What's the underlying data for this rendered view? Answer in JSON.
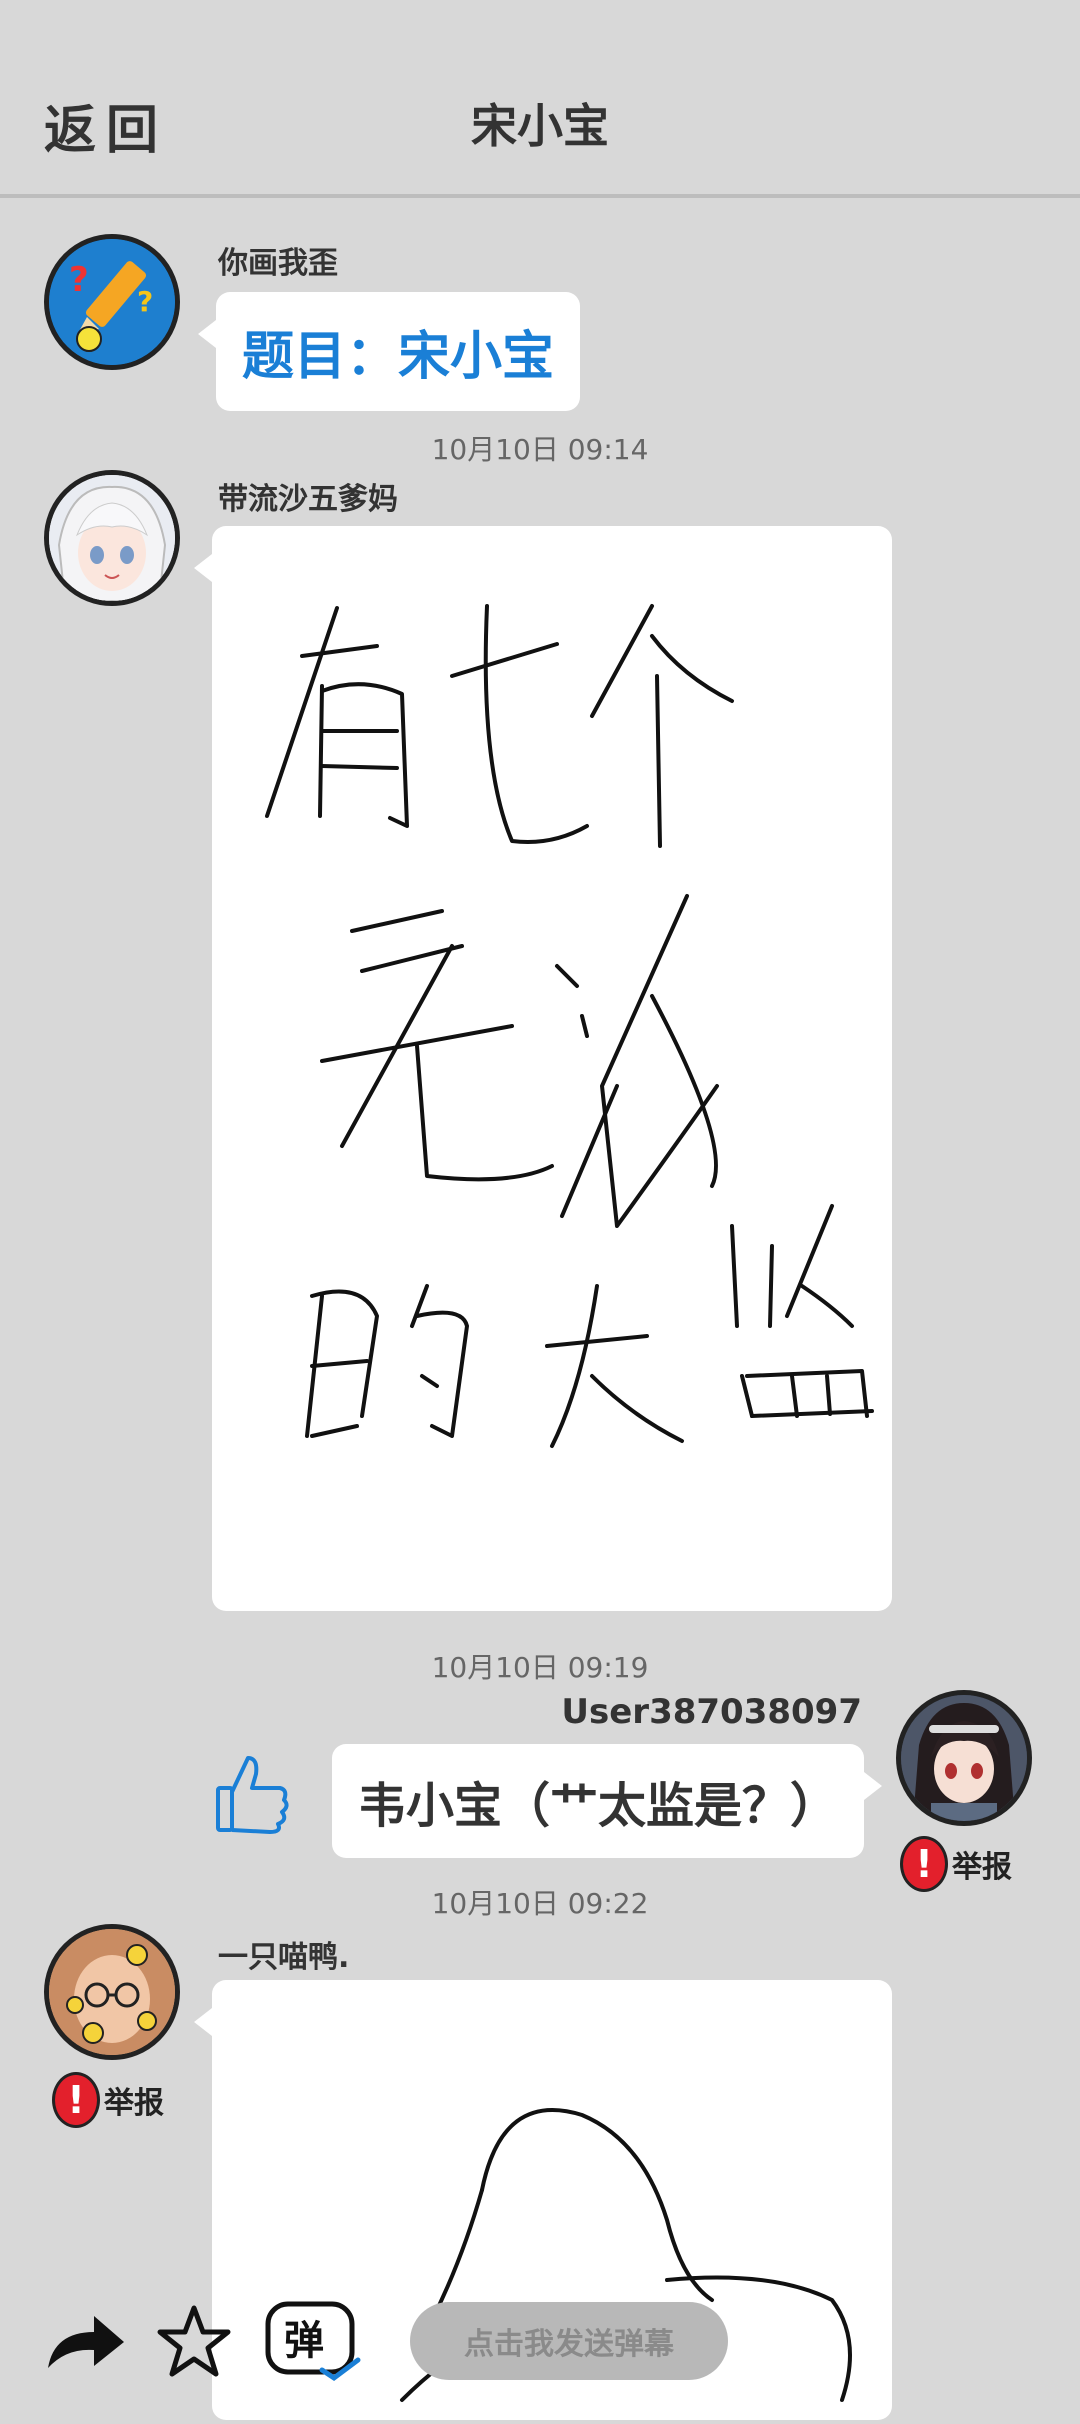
{
  "header": {
    "back_label": "返回",
    "title": "宋小宝"
  },
  "messages": [
    {
      "sender": "你画我歪",
      "text": "题目：宋小宝"
    },
    {
      "time": "10月10日  09:14",
      "sender": "带流沙五爹妈"
    },
    {
      "time": "10月10日  09:19",
      "sender": "User387038097",
      "text": "韦小宝（艹太监是？）",
      "report_label": "举报"
    },
    {
      "time": "10月10日  09:22",
      "sender": "一只喵鸭.",
      "report_label": "举报"
    }
  ],
  "bottom_bar": {
    "danmu_placeholder": "点击我发送弹幕",
    "danmu_icon_char": "弹"
  },
  "colors": {
    "background": "#d8d8d8",
    "topic_blue": "#1a7fd6",
    "report_red": "#e3202c"
  }
}
